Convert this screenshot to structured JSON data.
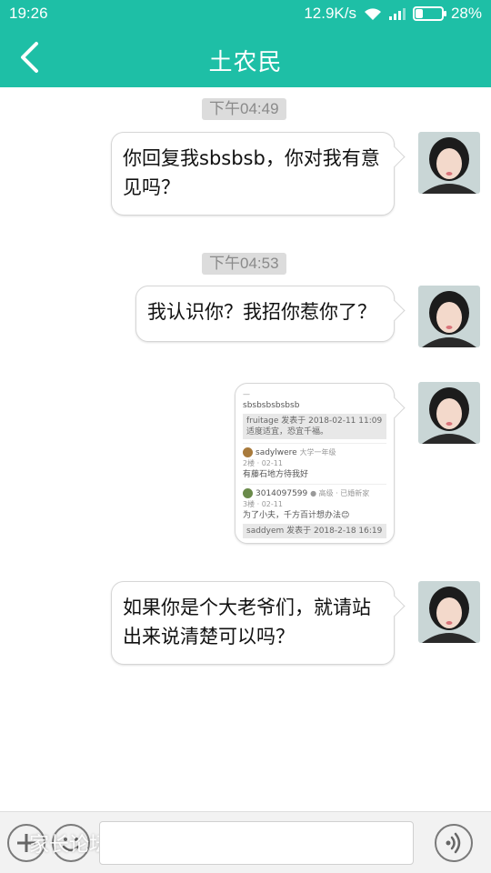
{
  "status": {
    "time": "19:26",
    "net_speed": "12.9K/s",
    "battery_pct": "28%",
    "battery_level": 0.28
  },
  "header": {
    "title": "土农民",
    "back_icon": "chevron-left-icon",
    "color": "#1ebfa6"
  },
  "messages": [
    {
      "timestamp": "下午04:49",
      "text": "你回复我sbsbsb，你对我有意见吗？"
    },
    {
      "timestamp": "下午04:53",
      "text": "我认识你？我招你惹你了？"
    },
    {
      "image": {
        "header": "sbsbsbsbsbsb",
        "quote1": "fruitage 发表于 2018-02-11 11:09",
        "quote1_body": "适度适宜，恐宜千福。",
        "user1": "sadylwere",
        "user1_badge": "大学一年级",
        "user1_meta": "2楼 · 02-11",
        "reply1": "有藤石地方待我好",
        "user2": "3014097599",
        "user2_badge": "● 高级 · 已婚新家",
        "user2_meta": "3楼 · 02-11",
        "reply2": "为了小夫，千方百计想办法😊",
        "quote2": "saddyem 发表于 2018-2-18 16:19"
      }
    },
    {
      "text": "如果你是个大老爷们，就请站出来说清楚可以吗？"
    }
  ],
  "input": {
    "plus_icon": "plus-icon",
    "emoji_icon": "emoji-icon",
    "voice_icon": "voice-icon",
    "placeholder": "",
    "watermark": "家长论坛"
  }
}
